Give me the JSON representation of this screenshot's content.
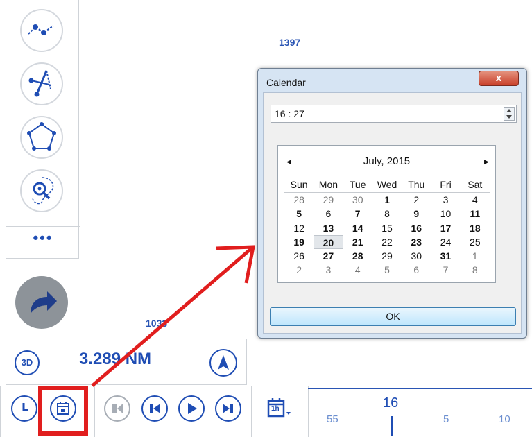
{
  "map": {
    "label_top": "1397",
    "label_bottom": "1033"
  },
  "tool_panel": {
    "tools": [
      {
        "name": "route-line-tool"
      },
      {
        "name": "measure-angle-tool"
      },
      {
        "name": "polygon-tool"
      },
      {
        "name": "search-area-tool"
      }
    ],
    "more_label": "•••"
  },
  "distance_panel": {
    "mode_label": "3D",
    "distance": "3.289 NM"
  },
  "timeline": {
    "hour": "16",
    "ticks": [
      "55",
      "5",
      "10"
    ],
    "interval_label": "1h"
  },
  "calendar_dialog": {
    "title": "Calendar",
    "close_label": "x",
    "time_value": "16 : 27",
    "month_title": "July, 2015",
    "day_headers": [
      "Sun",
      "Mon",
      "Tue",
      "Wed",
      "Thu",
      "Fri",
      "Sat"
    ],
    "weeks": [
      [
        {
          "d": "28",
          "o": 1
        },
        {
          "d": "29",
          "o": 1
        },
        {
          "d": "30",
          "o": 1
        },
        {
          "d": "1",
          "b": 1
        },
        {
          "d": "2"
        },
        {
          "d": "3"
        },
        {
          "d": "4"
        }
      ],
      [
        {
          "d": "5",
          "b": 1
        },
        {
          "d": "6"
        },
        {
          "d": "7",
          "b": 1
        },
        {
          "d": "8"
        },
        {
          "d": "9",
          "b": 1
        },
        {
          "d": "10"
        },
        {
          "d": "11",
          "b": 1
        }
      ],
      [
        {
          "d": "12"
        },
        {
          "d": "13",
          "b": 1
        },
        {
          "d": "14",
          "b": 1
        },
        {
          "d": "15"
        },
        {
          "d": "16",
          "b": 1
        },
        {
          "d": "17",
          "b": 1
        },
        {
          "d": "18",
          "b": 1
        }
      ],
      [
        {
          "d": "19",
          "b": 1
        },
        {
          "d": "20",
          "b": 1,
          "t": 1
        },
        {
          "d": "21",
          "b": 1
        },
        {
          "d": "22"
        },
        {
          "d": "23",
          "b": 1
        },
        {
          "d": "24"
        },
        {
          "d": "25"
        }
      ],
      [
        {
          "d": "26"
        },
        {
          "d": "27",
          "b": 1
        },
        {
          "d": "28",
          "b": 1
        },
        {
          "d": "29"
        },
        {
          "d": "30"
        },
        {
          "d": "31",
          "b": 1
        },
        {
          "d": "1",
          "o": 1
        }
      ],
      [
        {
          "d": "2",
          "o": 1
        },
        {
          "d": "3",
          "o": 1
        },
        {
          "d": "4",
          "o": 1
        },
        {
          "d": "5",
          "o": 1
        },
        {
          "d": "6",
          "o": 1
        },
        {
          "d": "7",
          "o": 1
        },
        {
          "d": "8",
          "o": 1
        }
      ]
    ],
    "ok_label": "OK"
  },
  "colors": {
    "accent": "#1f4db4",
    "annotation": "#e11e1e",
    "disabled": "#a7adb5"
  }
}
